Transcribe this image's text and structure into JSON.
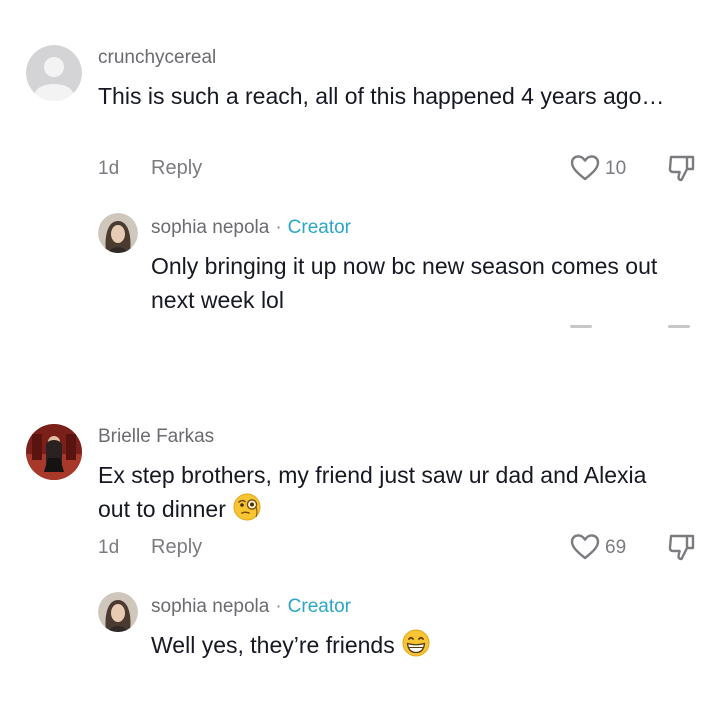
{
  "comments": [
    {
      "username": "crunchycereal",
      "text": "This is such a reach, all of this happened 4 years ago…",
      "time": "1d",
      "reply_label": "Reply",
      "likes": "10",
      "avatar": "default-avatar-icon",
      "replies": [
        {
          "username": "sophia nepola",
          "separator": "·",
          "badge": "Creator",
          "text": "Only bringing it up now bc new season comes out next week lol"
        }
      ]
    },
    {
      "username": "Brielle Farkas",
      "text": "Ex step brothers, my friend just saw ur dad and Alexia out to dinner",
      "emoji": "face-with-monocle-icon",
      "time": "1d",
      "reply_label": "Reply",
      "likes": "69",
      "replies": [
        {
          "username": "sophia nepola",
          "separator": "·",
          "badge": "Creator",
          "text": "Well yes, they’re friends",
          "emoji": "grinning-face-icon"
        }
      ]
    }
  ],
  "colors": {
    "creator_badge": "#2ba6c9",
    "text": "#161823",
    "muted": "#7b7b80"
  }
}
